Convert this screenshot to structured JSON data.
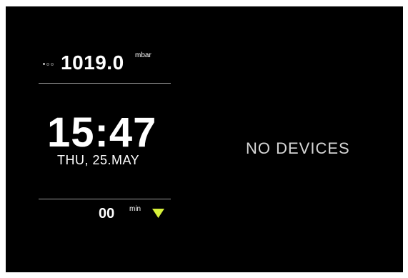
{
  "pressure": {
    "value": "1019.0",
    "unit": "mbar",
    "indicator_dots": [
      "filled",
      "empty",
      "empty"
    ]
  },
  "clock": {
    "time": "15:47",
    "date": "THU, 25.MAY"
  },
  "timer": {
    "value": "00",
    "unit": "min",
    "toggle_icon": "triangle-down-icon",
    "toggle_color": "#d6f03a"
  },
  "devices": {
    "status": "NO DEVICES"
  },
  "colors": {
    "background": "#000000",
    "text": "#ffffff",
    "accent": "#d6f03a",
    "divider": "#9a9a9a"
  }
}
